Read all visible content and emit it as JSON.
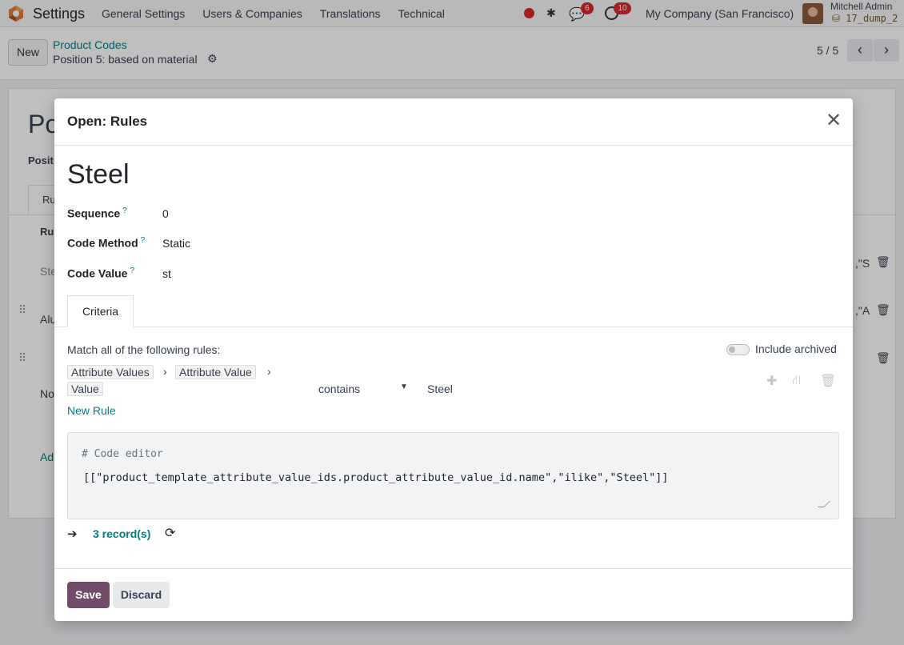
{
  "navbar": {
    "app_title": "Settings",
    "menu": [
      "General Settings",
      "Users & Companies",
      "Translations",
      "Technical"
    ],
    "chat_count": "6",
    "activity_count": "10",
    "company": "My Company (San Francisco)",
    "user_name": "Mitchell Admin",
    "db_name": "17_dump_2"
  },
  "control_panel": {
    "new_label": "New",
    "breadcrumb_parent": "Product Codes",
    "breadcrumb_current": "Position 5: based on material",
    "pager": "5 / 5"
  },
  "background": {
    "title_fragment": "Po",
    "field_fragment": "Posit",
    "tab_fragment": "Ru",
    "col_fragment": "Ru",
    "row1": "Ste",
    "row1_tail": ",\"S",
    "row2": "Alu",
    "row2_tail": ",\"A",
    "row3": "No",
    "add_line": "Ad"
  },
  "modal": {
    "title": "Open: Rules",
    "record_name": "Steel",
    "fields": {
      "sequence_label": "Sequence",
      "sequence_value": "0",
      "code_method_label": "Code Method",
      "code_method_value": "Static",
      "code_value_label": "Code Value",
      "code_value_value": "st",
      "help_mark": "?"
    },
    "tab_label": "Criteria",
    "domain": {
      "match_label": "Match all of the following rules:",
      "include_archived": "Include archived",
      "path": [
        "Attribute Values",
        "Attribute Value",
        "Value"
      ],
      "operator": "contains",
      "value": "Steel",
      "new_rule": "New Rule",
      "code_comment": "# Code editor",
      "code": "[[\"product_template_attribute_value_ids.product_attribute_value_id.name\",\"ilike\",\"Steel\"]]",
      "records": "3 record(s)"
    },
    "save_label": "Save",
    "discard_label": "Discard"
  },
  "colors": {
    "primary": "#714b67",
    "link": "#017e84",
    "danger": "#d9262b"
  }
}
